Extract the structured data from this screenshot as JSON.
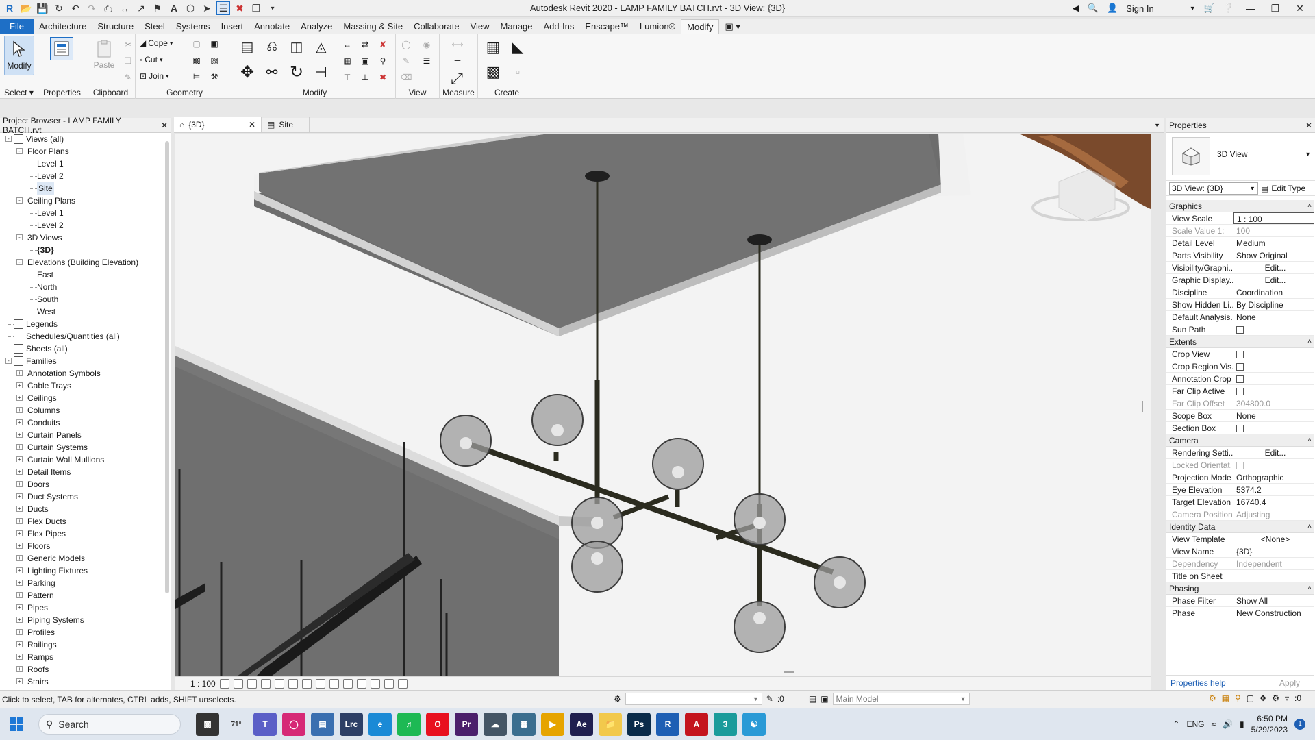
{
  "titlebar": {
    "title": "Autodesk Revit 2020 - LAMP FAMILY BATCH.rvt - 3D View: {3D}",
    "sign_in": "Sign In"
  },
  "menu": {
    "tabs": [
      "File",
      "Architecture",
      "Structure",
      "Steel",
      "Systems",
      "Insert",
      "Annotate",
      "Analyze",
      "Massing & Site",
      "Collaborate",
      "View",
      "Manage",
      "Add-Ins",
      "Enscape™",
      "Lumion®",
      "Modify"
    ],
    "active_tab": "Modify"
  },
  "ribbon": {
    "modify_label": "Modify",
    "properties_label": "Properties",
    "paste_label": "Paste",
    "cope_label": "Cope",
    "cut_label": "Cut",
    "join_label": "Join",
    "groups": {
      "select": "Select",
      "properties": "Properties",
      "clipboard": "Clipboard",
      "geometry": "Geometry",
      "modify": "Modify",
      "view": "View",
      "measure": "Measure",
      "create": "Create"
    }
  },
  "project_browser": {
    "title": "Project Browser - LAMP FAMILY BATCH.rvt",
    "tree": [
      {
        "label": "Views (all)",
        "level": 0,
        "toggle": "-",
        "icon": "views"
      },
      {
        "label": "Floor Plans",
        "level": 1,
        "toggle": "-"
      },
      {
        "label": "Level 1",
        "level": 2
      },
      {
        "label": "Level 2",
        "level": 2
      },
      {
        "label": "Site",
        "level": 2,
        "selected": true
      },
      {
        "label": "Ceiling Plans",
        "level": 1,
        "toggle": "-"
      },
      {
        "label": "Level 1",
        "level": 2
      },
      {
        "label": "Level 2",
        "level": 2
      },
      {
        "label": "3D Views",
        "level": 1,
        "toggle": "-"
      },
      {
        "label": "{3D}",
        "level": 2,
        "bold": true
      },
      {
        "label": "Elevations (Building Elevation)",
        "level": 1,
        "toggle": "-"
      },
      {
        "label": "East",
        "level": 2
      },
      {
        "label": "North",
        "level": 2
      },
      {
        "label": "South",
        "level": 2
      },
      {
        "label": "West",
        "level": 2
      },
      {
        "label": "Legends",
        "level": 0,
        "icon": "legend"
      },
      {
        "label": "Schedules/Quantities (all)",
        "level": 0,
        "icon": "schedule"
      },
      {
        "label": "Sheets (all)",
        "level": 0,
        "icon": "sheet"
      },
      {
        "label": "Families",
        "level": 0,
        "toggle": "-",
        "icon": "family"
      },
      {
        "label": "Annotation Symbols",
        "level": 1,
        "toggle": "+"
      },
      {
        "label": "Cable Trays",
        "level": 1,
        "toggle": "+"
      },
      {
        "label": "Ceilings",
        "level": 1,
        "toggle": "+"
      },
      {
        "label": "Columns",
        "level": 1,
        "toggle": "+"
      },
      {
        "label": "Conduits",
        "level": 1,
        "toggle": "+"
      },
      {
        "label": "Curtain Panels",
        "level": 1,
        "toggle": "+"
      },
      {
        "label": "Curtain Systems",
        "level": 1,
        "toggle": "+"
      },
      {
        "label": "Curtain Wall Mullions",
        "level": 1,
        "toggle": "+"
      },
      {
        "label": "Detail Items",
        "level": 1,
        "toggle": "+"
      },
      {
        "label": "Doors",
        "level": 1,
        "toggle": "+"
      },
      {
        "label": "Duct Systems",
        "level": 1,
        "toggle": "+"
      },
      {
        "label": "Ducts",
        "level": 1,
        "toggle": "+"
      },
      {
        "label": "Flex Ducts",
        "level": 1,
        "toggle": "+"
      },
      {
        "label": "Flex Pipes",
        "level": 1,
        "toggle": "+"
      },
      {
        "label": "Floors",
        "level": 1,
        "toggle": "+"
      },
      {
        "label": "Generic Models",
        "level": 1,
        "toggle": "+"
      },
      {
        "label": "Lighting Fixtures",
        "level": 1,
        "toggle": "+"
      },
      {
        "label": "Parking",
        "level": 1,
        "toggle": "+"
      },
      {
        "label": "Pattern",
        "level": 1,
        "toggle": "+"
      },
      {
        "label": "Pipes",
        "level": 1,
        "toggle": "+"
      },
      {
        "label": "Piping Systems",
        "level": 1,
        "toggle": "+"
      },
      {
        "label": "Profiles",
        "level": 1,
        "toggle": "+"
      },
      {
        "label": "Railings",
        "level": 1,
        "toggle": "+"
      },
      {
        "label": "Ramps",
        "level": 1,
        "toggle": "+"
      },
      {
        "label": "Roofs",
        "level": 1,
        "toggle": "+"
      },
      {
        "label": "Stairs",
        "level": 1,
        "toggle": "+"
      }
    ]
  },
  "view_tabs": [
    {
      "label": "{3D}",
      "active": true
    },
    {
      "label": "Site",
      "active": false
    }
  ],
  "view_controls": {
    "scale": "1 : 100"
  },
  "properties": {
    "title": "Properties",
    "type_name": "3D View",
    "selector": "3D View: {3D}",
    "edit_type": "Edit Type",
    "help": "Properties help",
    "apply": "Apply",
    "sections": [
      {
        "name": "Graphics",
        "rows": [
          {
            "name": "View Scale",
            "value": "1 : 100",
            "boxed": true
          },
          {
            "name": "Scale Value    1:",
            "value": "100",
            "disabled": true
          },
          {
            "name": "Detail Level",
            "value": "Medium"
          },
          {
            "name": "Parts Visibility",
            "value": "Show Original"
          },
          {
            "name": "Visibility/Graphi...",
            "value": "Edit...",
            "button": true
          },
          {
            "name": "Graphic Display...",
            "value": "Edit...",
            "button": true
          },
          {
            "name": "Discipline",
            "value": "Coordination"
          },
          {
            "name": "Show Hidden Li...",
            "value": "By Discipline"
          },
          {
            "name": "Default Analysis...",
            "value": "None"
          },
          {
            "name": "Sun Path",
            "checkbox": true
          }
        ]
      },
      {
        "name": "Extents",
        "rows": [
          {
            "name": "Crop View",
            "checkbox": true
          },
          {
            "name": "Crop Region Vis...",
            "checkbox": true
          },
          {
            "name": "Annotation Crop",
            "checkbox": true
          },
          {
            "name": "Far Clip Active",
            "checkbox": true
          },
          {
            "name": "Far Clip Offset",
            "value": "304800.0",
            "disabled": true
          },
          {
            "name": "Scope Box",
            "value": "None"
          },
          {
            "name": "Section Box",
            "checkbox": true
          }
        ]
      },
      {
        "name": "Camera",
        "rows": [
          {
            "name": "Rendering Setti...",
            "value": "Edit...",
            "button": true
          },
          {
            "name": "Locked Orientat...",
            "checkbox": true,
            "disabled": true
          },
          {
            "name": "Projection Mode",
            "value": "Orthographic"
          },
          {
            "name": "Eye Elevation",
            "value": "5374.2"
          },
          {
            "name": "Target Elevation",
            "value": "16740.4"
          },
          {
            "name": "Camera Position",
            "value": "Adjusting",
            "disabled": true
          }
        ]
      },
      {
        "name": "Identity Data",
        "rows": [
          {
            "name": "View Template",
            "value": "<None>",
            "button": true
          },
          {
            "name": "View Name",
            "value": "{3D}"
          },
          {
            "name": "Dependency",
            "value": "Independent",
            "disabled": true
          },
          {
            "name": "Title on Sheet",
            "value": ""
          }
        ]
      },
      {
        "name": "Phasing",
        "rows": [
          {
            "name": "Phase Filter",
            "value": "Show All"
          },
          {
            "name": "Phase",
            "value": "New Construction"
          }
        ]
      }
    ]
  },
  "statusbar": {
    "message": "Click to select, TAB for alternates, CTRL adds, SHIFT unselects.",
    "count": ":0",
    "model": "Main Model",
    "filter_count": ":0"
  },
  "taskbar": {
    "search_placeholder": "Search",
    "weather": "71°",
    "language": "ENG",
    "time": "6:50 PM",
    "date": "5/29/2023",
    "notifications": "1"
  }
}
